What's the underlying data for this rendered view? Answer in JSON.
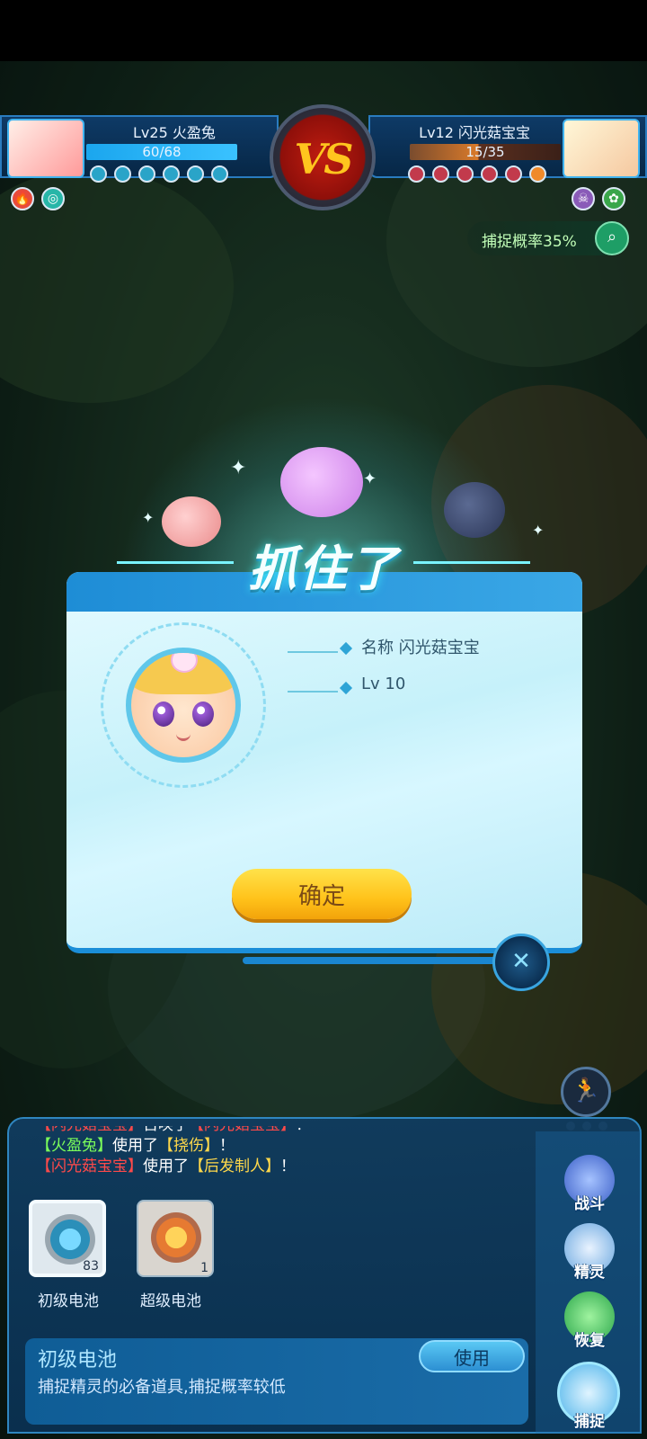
{
  "player": {
    "level_name": "Lv25 火盈兔",
    "hp_text": "60/68",
    "hp_fraction": 0.88,
    "pips": 6,
    "element_icons": [
      "fire-icon",
      "wind-icon"
    ]
  },
  "enemy": {
    "level_name": "Lv12 闪光菇宝宝",
    "hp_text": "15/35",
    "hp_fraction": 0.43,
    "pips": 6,
    "element_icons": [
      "poison-icon",
      "grass-icon"
    ]
  },
  "vs_label": "VS",
  "capture_rate": "捕捉概率35%",
  "dialog": {
    "title": "抓住了",
    "name_line": "名称 闪光菇宝宝",
    "level_line": "Lv 10",
    "confirm_label": "确定",
    "close_icon": "close-icon"
  },
  "battle_log": [
    [
      {
        "t": "【闪光菇宝宝】",
        "c": "red"
      },
      {
        "t": "召唤了",
        "c": "white"
      },
      {
        "t": "【闪光菇宝宝】",
        "c": "red"
      },
      {
        "t": "！",
        "c": "white"
      }
    ],
    [
      {
        "t": "【火盈兔】",
        "c": "green"
      },
      {
        "t": "使用了",
        "c": "white"
      },
      {
        "t": "【挠伤】",
        "c": "yellow"
      },
      {
        "t": "！",
        "c": "white"
      }
    ],
    [
      {
        "t": "【闪光菇宝宝】",
        "c": "red"
      },
      {
        "t": "使用了",
        "c": "white"
      },
      {
        "t": "【后发制人】",
        "c": "yellow"
      },
      {
        "t": "！",
        "c": "white"
      }
    ]
  ],
  "items": [
    {
      "label": "初级电池",
      "count": "83",
      "selected": true
    },
    {
      "label": "超级电池",
      "count": "1",
      "selected": false
    }
  ],
  "selected_item": {
    "title": "初级电池",
    "description": "捕捉精灵的必备道具,捕捉概率较低",
    "use_label": "使用"
  },
  "side_menu": [
    {
      "label": "战斗",
      "icon": "sword-icon"
    },
    {
      "label": "精灵",
      "icon": "spirit-icon"
    },
    {
      "label": "恢复",
      "icon": "potion-icon"
    },
    {
      "label": "捕捉",
      "icon": "capture-icon"
    }
  ],
  "flee_icon": "run-icon"
}
